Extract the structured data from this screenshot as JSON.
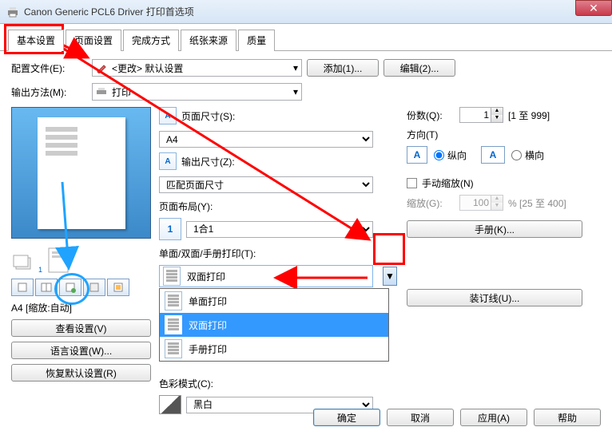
{
  "window": {
    "title": "Canon Generic PCL6 Driver 打印首选项"
  },
  "tabs": [
    "基本设置",
    "页面设置",
    "完成方式",
    "纸张来源",
    "质量"
  ],
  "profile": {
    "label": "配置文件(E):",
    "value": "<更改> 默认设置",
    "add_btn": "添加(1)...",
    "edit_btn": "编辑(2)..."
  },
  "output": {
    "label": "输出方法(M):",
    "value": "打印"
  },
  "preview": {
    "caption": "A4 [缩放:自动]"
  },
  "left_buttons": {
    "view": "查看设置(V)",
    "lang": "语言设置(W)...",
    "restore": "恢复默认设置(R)"
  },
  "page_size": {
    "label": "页面尺寸(S):",
    "value": "A4"
  },
  "output_size": {
    "label": "输出尺寸(Z):",
    "value": "匹配页面尺寸"
  },
  "layout": {
    "label": "页面布局(Y):",
    "value": "1合1"
  },
  "duplex": {
    "label": "单面/双面/手册打印(T):",
    "value": "双面打印",
    "options": [
      "单面打印",
      "双面打印",
      "手册打印"
    ]
  },
  "colormode": {
    "label": "色彩模式(C):",
    "value": "黑白"
  },
  "copies": {
    "label": "份数(Q):",
    "value": "1",
    "range": "[1 至 999]"
  },
  "orient": {
    "label": "方向(T)",
    "portrait": "纵向",
    "landscape": "横向"
  },
  "manual_scale": {
    "label": "手动缩放(N)"
  },
  "scale": {
    "label": "缩放(G):",
    "value": "100",
    "range": "% [25 至 400]"
  },
  "booklet_btn": "手册(K)...",
  "binding_btn": "装订线(U)...",
  "footer": {
    "ok": "确定",
    "cancel": "取消",
    "apply": "应用(A)",
    "help": "帮助"
  }
}
